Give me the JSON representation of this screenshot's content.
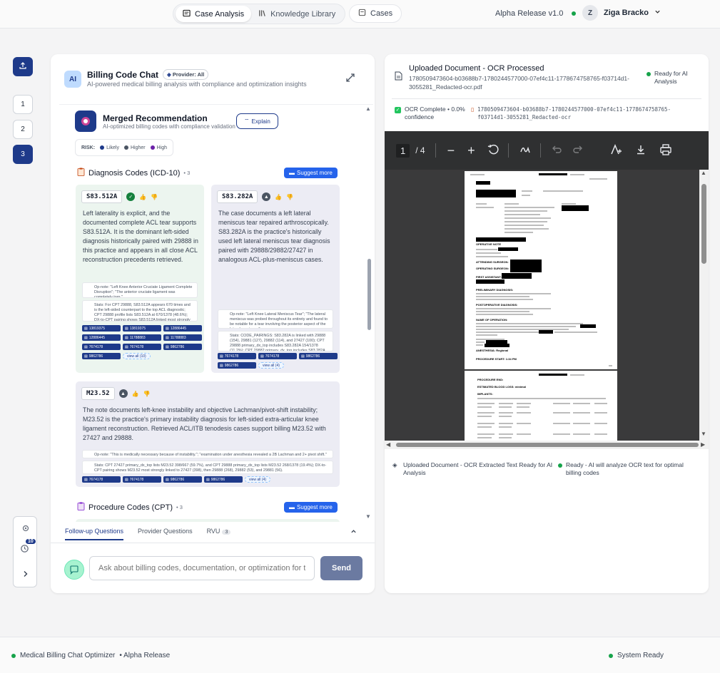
{
  "nav": {
    "tabs": [
      {
        "label": "Case Analysis",
        "active": true
      },
      {
        "label": "Knowledge Library",
        "active": false
      }
    ],
    "cases_label": "Cases",
    "release": "Alpha Release v1.0",
    "user_initial": "Z",
    "user_name": "Ziga Bracko"
  },
  "rail": {
    "steps": [
      "1",
      "2",
      "3"
    ],
    "active_step": "3",
    "history_badge": "10"
  },
  "chat": {
    "badge": "AI",
    "title": "Billing Code Chat",
    "provider": "Provider: All",
    "subtitle": "AI-powered medical billing analysis with compliance and optimization insights",
    "merged": {
      "title": "Merged Recommendation",
      "subtitle": "AI-optimized billing codes with compliance validation",
      "explain_label": "Explain"
    },
    "risk": {
      "label": "RISK:",
      "levels": [
        {
          "label": "Likely",
          "color": "#1e3a8a"
        },
        {
          "label": "Higher",
          "color": "#4b5563"
        },
        {
          "label": "High",
          "color": "#6b21a8"
        }
      ]
    },
    "diagnosis": {
      "title": "Diagnosis Codes (ICD-10)",
      "count": "• 3",
      "suggest_label": "Suggest more",
      "cards": [
        {
          "code": "S83.512A",
          "description": "Left laterality is explicit, and the documented complete ACL tear supports S83.512A. It is the dominant left-sided diagnosis historically paired with 29888 in this practice and appears in all close ACL reconstruction precedents retrieved.",
          "quote1": "Op-note: \"Left Knee Anterior Cruciate Ligament Complete Disruption\"; \"The anterior cruciate ligament was completely torn.\"",
          "quote2": "Stats: For CPT 29888, S83.512A appears 670 times and is the left-sided counterpart to the top ACL diagnostic; CPT 29888 profile lists S83.512A at 670/1378 (48.6%); DX-to-CPT pairing shows S83.512A linked most strongly to 29888 (670), plus 27427 (71) and 29882 (230).",
          "claims": [
            "13819375",
            "13819375",
            "12886445",
            "12886445",
            "11788883",
            "11788883",
            "7674178",
            "7674178",
            "9862786",
            "9862786"
          ],
          "view_all": "view all (10)"
        },
        {
          "code": "S83.282A",
          "description": "The case documents a left lateral meniscus tear repaired arthroscopically. S83.282A is the practice's historically used left lateral meniscus tear diagnosis paired with 29888/29882/27427 in analogous ACL-plus-meniscus cases.",
          "quote1": "Op-note: \"Left Knee Lateral Meniscus Tear\"; \"The lateral meniscus was probed throughout its entirety and found to be notable for a tear involving the posterior aspect of the lateral meniscus.\"",
          "quote2": "Stats: CODE_PAIRINGS: S83.282A is linked with 29888 (154), 29881 (127), 29882 (114), and 27427 (100); CPT 29888 primary_dx_top includes S83.282A 154/1378 (11.2%); CPT 29882 primary_dx_top includes S83.282A 114/778 (14.6%).",
          "claims": [
            "7674178",
            "7674178",
            "9862786",
            "9862786"
          ],
          "view_all": "view all (4)"
        },
        {
          "code": "M23.52",
          "description": "The note documents left-knee instability and objective Lachman/pivot-shift instability; M23.52 is the practice's primary instability diagnosis for left-sided extra-articular knee ligament reconstruction. Retrieved ACL/ITB tenodesis cases support billing M23.52 with 27427 and 29888.",
          "quote1": "Op-note: \"This is medically necessary because of instability.\"; \"examination under anesthesia revealed a 2B Lachman and 2+ pivot shift.\"",
          "quote2": "Stats: CPT 27427 primary_dx_top lists M23.52 398/667 (59.7%), and CPT 29888 primary_dx_top lists M23.52 268/1378 (19.4%); DX-to-CPT pairing shows M23.52 most strongly linked to 27427 (398), then 29888 (268), 29882 (53), and 29881 (56).",
          "claims": [
            "7674178",
            "7674178",
            "9862786",
            "9862786"
          ],
          "view_all": "view all (4)"
        }
      ]
    },
    "procedure": {
      "title": "Procedure Codes (CPT)",
      "count": "• 3",
      "suggest_label": "Suggest more"
    },
    "subtabs": [
      "Follow-up Questions",
      "Provider Questions",
      "RVU"
    ],
    "rvu_count": "3",
    "input_placeholder": "Ask about billing codes, documentation, or optimization for this case",
    "send_label": "Send"
  },
  "document": {
    "title": "Uploaded Document - OCR Processed",
    "filename": "1780509473604-b03688b7-1780244577000-07ef4c11-1778674758765-f03714d1-3055281_Redacted-ocr.pdf",
    "ready_status": "Ready for AI Analysis",
    "ocr_status": "OCR Complete • 0.0% confidence",
    "ocr_filename": "1780509473604-b03688b7-1780244577000-07ef4c11-1778674758765-f03714d1-3055281_Redacted-ocr",
    "page_current": "1",
    "page_total": "/ 4",
    "footer_left": "Uploaded Document - OCR Extracted Text Ready for AI Analysis",
    "footer_right": "Ready - AI will analyze OCR text for optimal billing codes"
  },
  "pdf_text": {
    "operative_note": "OPERATIVE NOTE",
    "attending": "ATTENDING SURGEON:",
    "operating": "OPERATING SURGEON:",
    "first_assistant": "FIRST ASSISTANT:",
    "pre_dx": "PRELIMINARY DIAGNOSIS:",
    "post_dx": "POSTOPERATIVE DIAGNOSIS:",
    "name_op": "NAME OF OPERATION:",
    "anesthesia": "ANESTHESIA: Regional",
    "proc_start": "PROCEDURE START: 1:34 PM",
    "proc_end": "PROCEDURE END:",
    "blood_loss": "ESTIMATED BLOOD LOSS: minimal",
    "implants": "IMPLANTS:"
  },
  "footer": {
    "app_name": "Medical Billing Chat Optimizer",
    "release": "• Alpha Release",
    "system_status": "System Ready"
  }
}
